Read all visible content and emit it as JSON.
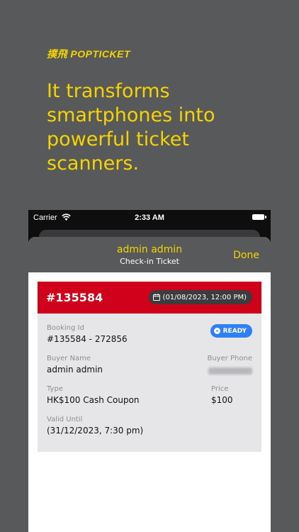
{
  "brand": {
    "name": "撲飛 POPTICKET"
  },
  "headline": "It transforms smartphones into powerful ticket scanners.",
  "status_bar": {
    "carrier": "Carrier",
    "time": "2:33 AM"
  },
  "sheet": {
    "title": "admin admin",
    "subtitle": "Check-in Ticket",
    "done_label": "Done"
  },
  "ticket": {
    "number": "#135584",
    "datetime": "(01/08/2023, 12:00 PM)",
    "status": "READY",
    "fields": {
      "booking_id_label": "Booking Id",
      "booking_id_value": "#135584 - 272856",
      "buyer_name_label": "Buyer Name",
      "buyer_name_value": "admin admin",
      "buyer_phone_label": "Buyer Phone",
      "type_label": "Type",
      "type_value": "HK$100 Cash Coupon",
      "price_label": "Price",
      "price_value": "$100",
      "valid_until_label": "Valid Until",
      "valid_until_value": "(31/12/2023, 7:30 pm)"
    }
  },
  "colors": {
    "accent": "#f5d400",
    "background": "#58595b",
    "ticket_header": "#d0021b",
    "ready_badge": "#2f7ff5"
  },
  "icons": [
    "wifi-icon",
    "battery-icon",
    "calendar-icon",
    "ready-icon"
  ]
}
